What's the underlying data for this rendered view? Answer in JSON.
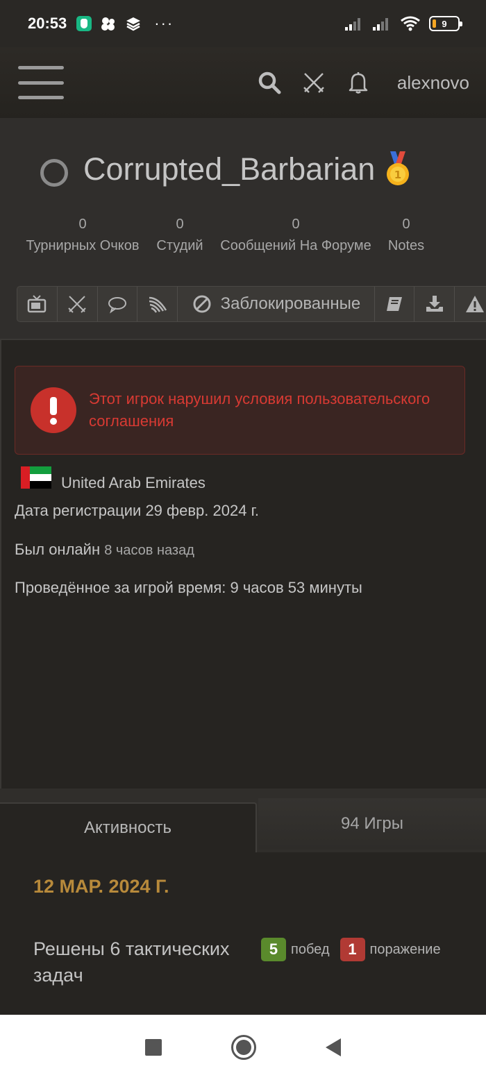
{
  "status_bar": {
    "time": "20:53",
    "overflow_dots": "···",
    "battery_level": "9"
  },
  "nav": {
    "menu_icon": "hamburger-icon",
    "search_icon": "search-icon",
    "swords_icon": "crossed-swords-icon",
    "bell_icon": "bell-icon",
    "username": "alexnovo"
  },
  "profile": {
    "name": "Corrupted_Barbarian",
    "medal": "🥇",
    "stats": [
      {
        "value": "0",
        "label": "Турнирных Очков"
      },
      {
        "value": "0",
        "label": "Студий"
      },
      {
        "value": "0",
        "label": "Сообщений На Форуме"
      },
      {
        "value": "0",
        "label": "Notes"
      }
    ],
    "tabs": {
      "blocked_label": "Заблокированные"
    }
  },
  "alert": {
    "text": "Этот игрок нарушил условия пользовательского соглашения"
  },
  "info": {
    "country": "United Arab Emirates",
    "registered": "Дата регистрации 29 февр. 2024 г.",
    "last_online_label": "Был онлайн",
    "last_online_value": "8 часов назад",
    "play_time": "Проведённое за игрой время: 9 часов 53 минуты"
  },
  "bottom_tabs": {
    "activity": "Активность",
    "games": "94 Игры"
  },
  "activity": {
    "date": "12 МАР. 2024 Г.",
    "text": "Решены 6 тактических задач",
    "wins": "5",
    "wins_label": "побед",
    "losses": "1",
    "losses_label": "поражение"
  },
  "colors": {
    "accent_date": "#b88a3b",
    "alert_red": "#d83a33",
    "win_green": "#5a8a2c",
    "loss_red": "#b13a34"
  }
}
